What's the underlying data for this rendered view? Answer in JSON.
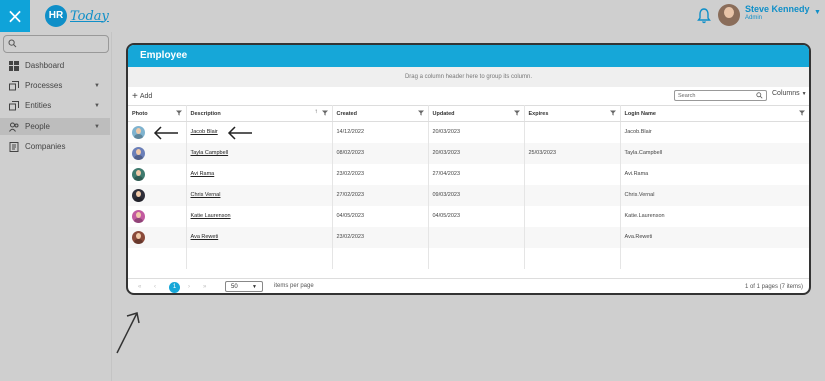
{
  "app": {
    "close_icon": "×",
    "logo_mark": "HR",
    "logo_text": "Today"
  },
  "user": {
    "name": "Steve Kennedy",
    "role": "Admin"
  },
  "sidebar": {
    "items": [
      {
        "label": "Dashboard",
        "icon": "dashboard-icon"
      },
      {
        "label": "Processes",
        "icon": "processes-icon"
      },
      {
        "label": "Entities",
        "icon": "entities-icon"
      },
      {
        "label": "People",
        "icon": "people-icon"
      },
      {
        "label": "Companies",
        "icon": "companies-icon"
      }
    ]
  },
  "grid": {
    "title": "Employee",
    "group_hint": "Drag a column header here to group its column.",
    "add_label": "Add",
    "search_placeholder": "Search",
    "columns_label": "Columns",
    "headers": [
      "Photo",
      "Description",
      "Created",
      "Updated",
      "Expires",
      "Login Name"
    ],
    "rows": [
      {
        "desc": "Jacob Blair",
        "created": "14/12/2022",
        "updated": "20/03/2023",
        "expires": "",
        "login": "Jacob.Blair",
        "photo_color": "#7fb3cf"
      },
      {
        "desc": "Tayla Campbell",
        "created": "08/02/2023",
        "updated": "20/03/2023",
        "expires": "25/03/2023",
        "login": "Tayla.Campbell",
        "photo_color": "#6b7fb8"
      },
      {
        "desc": "Avi Rama",
        "created": "23/02/2023",
        "updated": "27/04/2023",
        "expires": "",
        "login": "Avi.Rama",
        "photo_color": "#3f7a6e"
      },
      {
        "desc": "Chris Vernal",
        "created": "27/02/2023",
        "updated": "09/03/2023",
        "expires": "",
        "login": "Chris.Vernal",
        "photo_color": "#2f2f3a"
      },
      {
        "desc": "Katie Laurenson",
        "created": "04/05/2023",
        "updated": "04/05/2023",
        "expires": "",
        "login": "Katie.Laurenson",
        "photo_color": "#c25aa0"
      },
      {
        "desc": "Ava Reweti",
        "created": "23/02/2023",
        "updated": "",
        "expires": "",
        "login": "Ava.Reweti",
        "photo_color": "#8a4a3a"
      }
    ]
  },
  "pager": {
    "first": "«",
    "prev": "‹",
    "current": "1",
    "next": "›",
    "last": "»",
    "page_size": "50",
    "page_size_label": "items per page",
    "info": "1 of 1 pages (7 items)"
  },
  "colors": {
    "accent": "#16a7d8",
    "background": "#cfcfcf"
  }
}
